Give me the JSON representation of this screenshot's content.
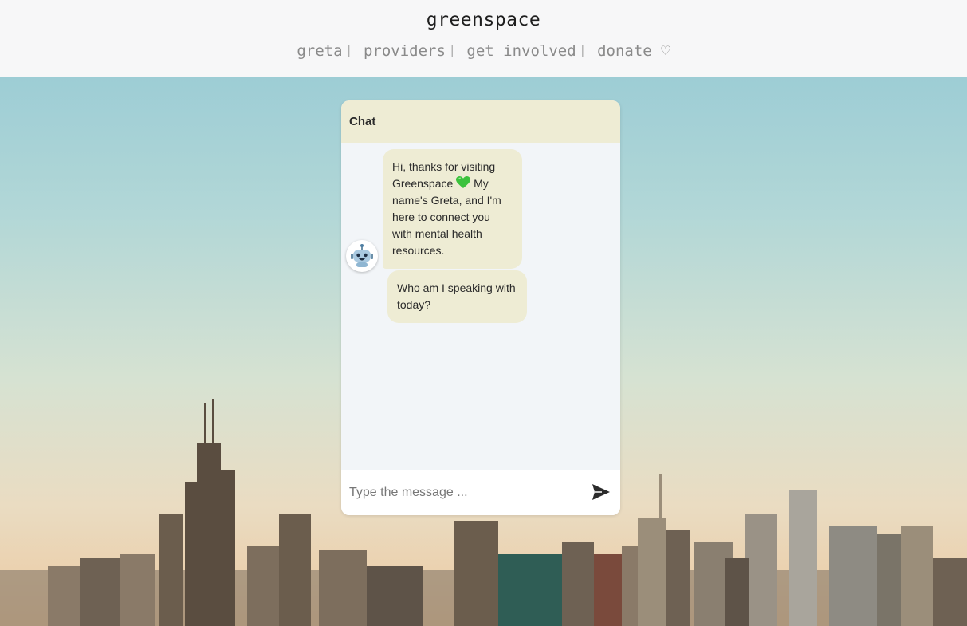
{
  "site": {
    "brand": "greenspace",
    "nav": {
      "greta": "greta",
      "providers": "providers",
      "get_involved": "get involved",
      "donate": "donate",
      "separator": "|"
    },
    "donate_icon": "♡"
  },
  "chat": {
    "title": "Chat",
    "messages": [
      {
        "sender": "bot",
        "before_icon": "Hi, thanks for visiting Greenspace",
        "icon": "green-heart-icon",
        "after_icon": "My name's Greta, and I'm here to connect you with mental health resources."
      },
      {
        "sender": "bot",
        "text": "Who am I speaking with today?"
      }
    ],
    "avatar_icon": "robot-icon",
    "input_placeholder": "Type the message ...",
    "send_icon": "send-icon"
  },
  "colors": {
    "header_bg": "#f7f7f8",
    "chat_header_bg": "#eeecd4",
    "bubble_bg": "#eeecd4",
    "chat_bg": "#f2f5f8",
    "heart_green": "#3cc23c"
  }
}
